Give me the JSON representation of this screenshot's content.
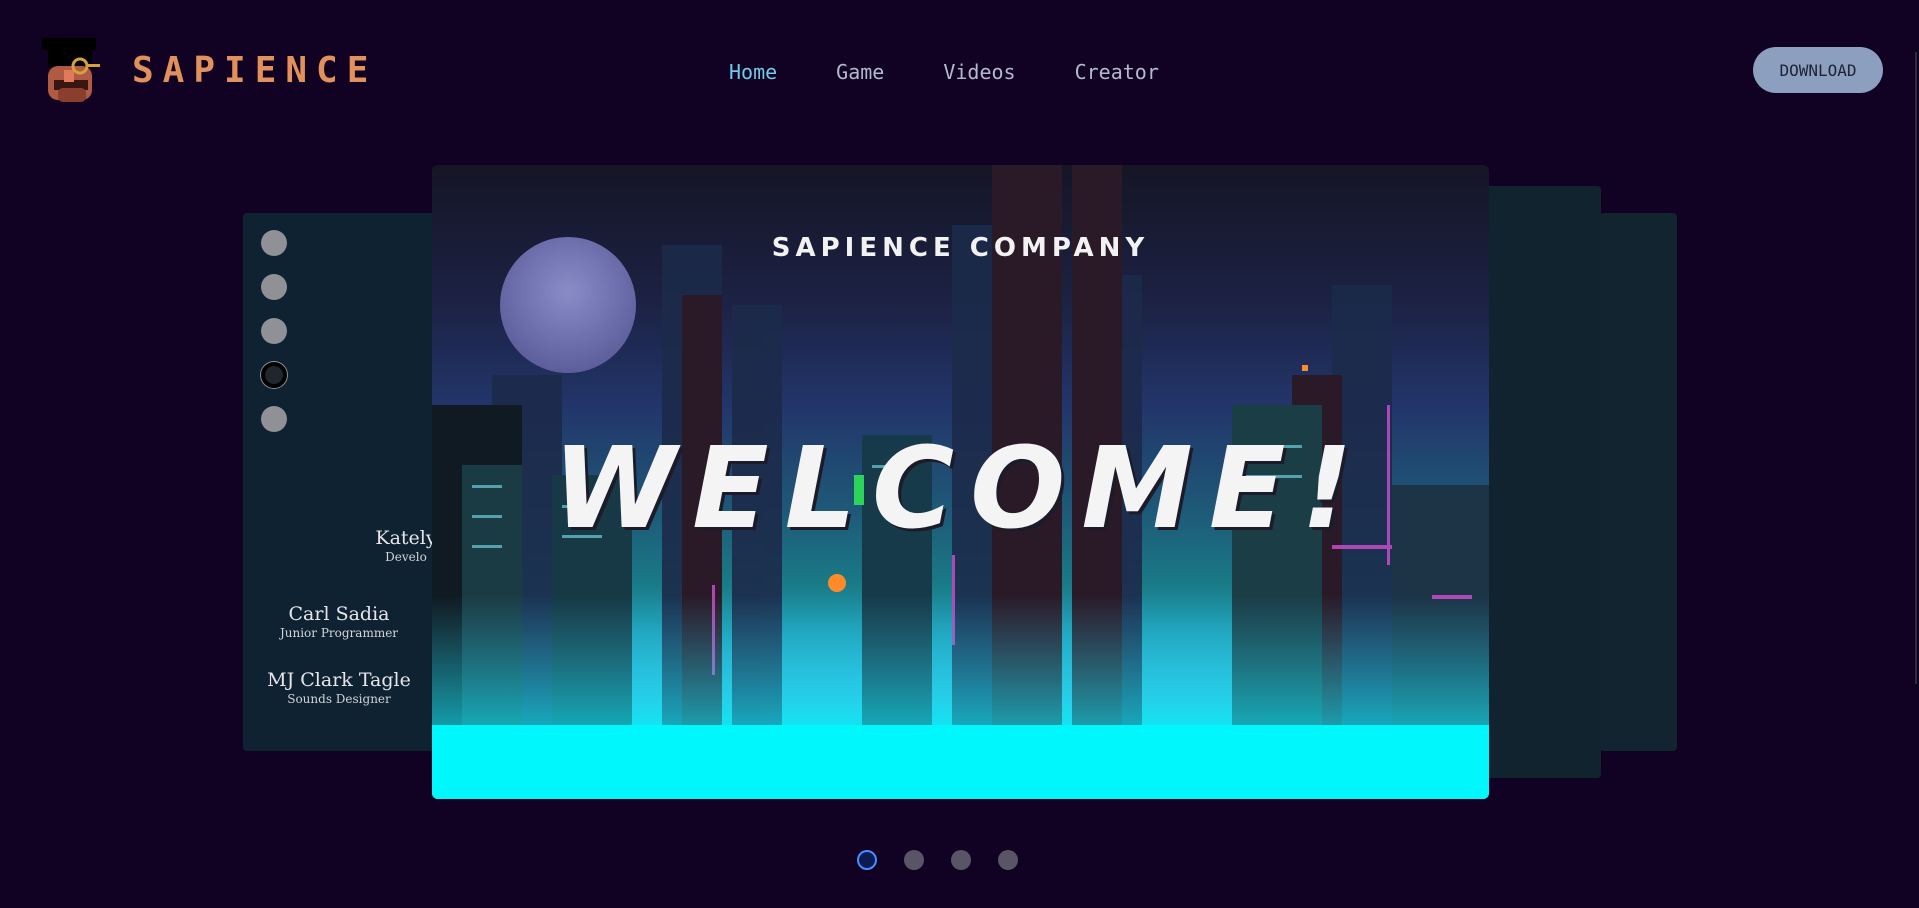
{
  "header": {
    "brand": "SAPIENCE",
    "nav": [
      "Home",
      "Game",
      "Videos",
      "Creator"
    ],
    "active_nav": "Home",
    "download_label": "DOWNLOAD"
  },
  "team_card": {
    "selected_radio": 4,
    "members": [
      {
        "name": "Kately",
        "role": "Develo"
      },
      {
        "name": "Carl Sadia",
        "role": "Junior Programmer"
      },
      {
        "name": "MJ Clark Tagle",
        "role": "Sounds Designer"
      }
    ]
  },
  "slide": {
    "subtitle": "SAPIENCE COMPANY",
    "title": "WELCOME!"
  },
  "carousel": {
    "total": 4,
    "active": 1
  },
  "colors": {
    "background": "#110224",
    "brand": "#e0915c",
    "nav_active": "#6ecae6",
    "nav": "#b4b9cc",
    "download_bg": "#8c9fbf",
    "card": "#0f2231",
    "cyan": "#00f7fb"
  }
}
